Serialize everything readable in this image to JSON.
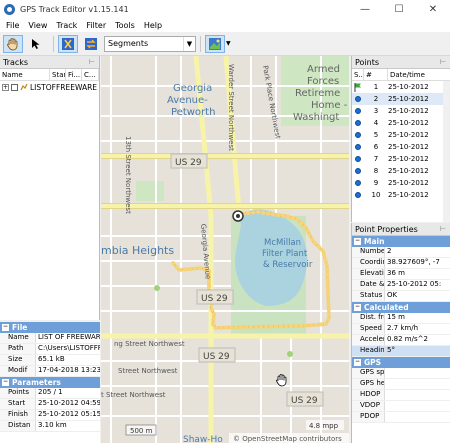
{
  "window": {
    "title": "GPS Track Editor v1.15.141",
    "minimize": "—",
    "maximize": "☐",
    "close": "✕"
  },
  "menu": [
    "File",
    "View",
    "Track",
    "Filter",
    "Tools",
    "Help"
  ],
  "toolbar": {
    "segments_value": "Segments"
  },
  "tracks": {
    "title": "Tracks",
    "columns": [
      "Name",
      "Start",
      "Fi...",
      "C..."
    ],
    "rows": [
      {
        "name": "LISTOFFREEWARE"
      }
    ]
  },
  "file_props": {
    "file_section": "File",
    "rows": [
      {
        "k": "Name",
        "v": "LIST OF FREEWARE"
      },
      {
        "k": "Path",
        "v": "C:\\Users\\LISTOFFRE"
      },
      {
        "k": "Size",
        "v": "65.1 kB"
      },
      {
        "k": "Modif",
        "v": "17-04-2018 13:23:3"
      }
    ],
    "params_section": "Parameters",
    "params": [
      {
        "k": "Points",
        "v": "205 / 1"
      },
      {
        "k": "Start",
        "v": "25-10-2012 04:59:40"
      },
      {
        "k": "Finish",
        "v": "25-10-2012 05:15:28"
      },
      {
        "k": "Distan",
        "v": "3.10 km"
      }
    ]
  },
  "points": {
    "title": "Points",
    "columns": [
      "S..",
      "#",
      "Date/time"
    ],
    "rows": [
      {
        "n": "1",
        "d": "25-10-2012",
        "flag": true
      },
      {
        "n": "2",
        "d": "25-10-2012",
        "selected": true
      },
      {
        "n": "3",
        "d": "25-10-2012"
      },
      {
        "n": "4",
        "d": "25-10-2012"
      },
      {
        "n": "5",
        "d": "25-10-2012"
      },
      {
        "n": "6",
        "d": "25-10-2012"
      },
      {
        "n": "7",
        "d": "25-10-2012"
      },
      {
        "n": "8",
        "d": "25-10-2012"
      },
      {
        "n": "9",
        "d": "25-10-2012"
      },
      {
        "n": "10",
        "d": "25-10-2012"
      }
    ]
  },
  "point_props": {
    "title": "Point Properties",
    "main_section": "Main",
    "main": [
      {
        "k": "Number",
        "v": "2"
      },
      {
        "k": "Coordina",
        "v": "38.927609°, -7"
      },
      {
        "k": "Elevation",
        "v": "36 m"
      },
      {
        "k": "Date & ti",
        "v": "25-10-2012 05:"
      },
      {
        "k": "Status",
        "v": "OK"
      }
    ],
    "calc_section": "Calculated",
    "calc": [
      {
        "k": "Dist. from",
        "v": "15 m"
      },
      {
        "k": "Speed",
        "v": "2.7 km/h"
      },
      {
        "k": "Accelerat",
        "v": "0.82 m/s^2"
      },
      {
        "k": "Heading",
        "v": "5°",
        "highlight": true
      }
    ],
    "gps_section": "GPS",
    "gps": [
      {
        "k": "GPS spee",
        "v": ""
      },
      {
        "k": "GPS head",
        "v": ""
      },
      {
        "k": "HDOP",
        "v": ""
      },
      {
        "k": "VDOP",
        "v": ""
      },
      {
        "k": "PDOP",
        "v": ""
      }
    ]
  },
  "map": {
    "labels": {
      "georgia_avenue": "Georgia",
      "georgia_avenue2": "Avenue-",
      "petworth": "Petworth",
      "armed": "Armed",
      "forces": "Forces",
      "retirement": "Retireme",
      "home": "Home -",
      "washington": "Washingt",
      "warder": "Warder Street Northwest",
      "park_place": "Park Place Northwest",
      "thirteenth": "13th Street Northwest",
      "columbia": "mbia Heights",
      "georgia_ave_vert": "Georgia Avenue",
      "mcmillan1": "McMillan",
      "mcmillan2": "Filter Plant",
      "mcmillan3": "& Reservoir",
      "us29_a": "US 29",
      "us29_b": "US 29",
      "us29_c": "US 29",
      "us29_d": "US 29",
      "street_nw1": "ng Street Northwest",
      "street_nw2": "Street Northwest",
      "street_nw3": "t Street Northwest",
      "shaw": "Shaw-Ho",
      "scale_m": "500 m",
      "scale_mi": "4.8 mpp",
      "attribution": "© OpenStreetMap contributors"
    }
  }
}
